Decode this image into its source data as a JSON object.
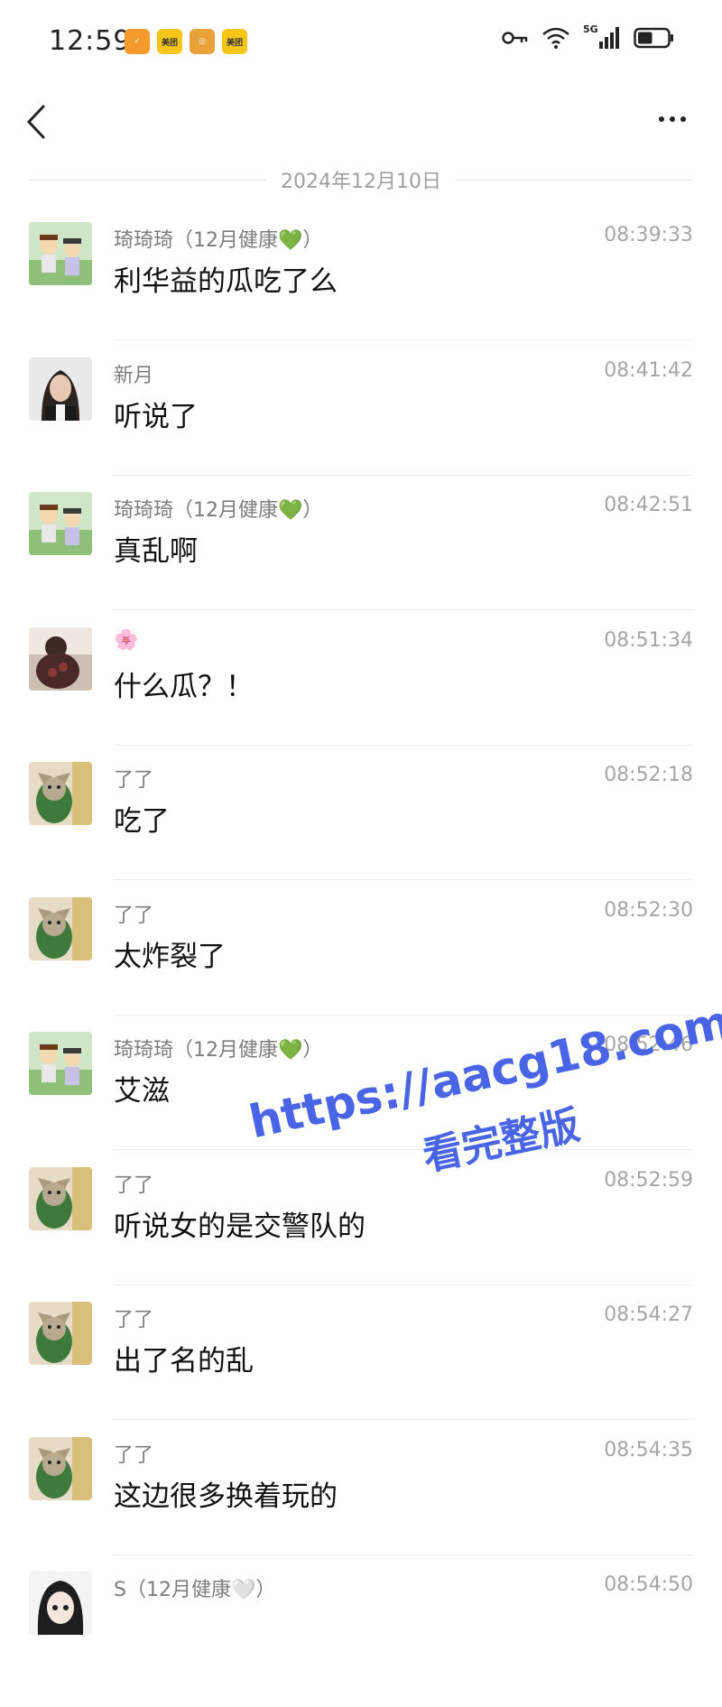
{
  "status_bar": {
    "time": "12:59",
    "notif_icons": [
      "app-icon",
      "meituan-icon",
      "game-icon",
      "meituan-icon"
    ],
    "network": "5G",
    "battery_level": 0.5
  },
  "nav": {
    "back_icon": "chevron-left-icon",
    "more_icon": "more-dots-icon"
  },
  "date_separator": "2024年12月10日",
  "messages": [
    {
      "sender": "琦琦琦（12月健康💚）",
      "time": "08:39:33",
      "text": "利华益的瓜吃了么",
      "avatar": "cartoon-avatar"
    },
    {
      "sender": "新月",
      "time": "08:41:42",
      "text": "听说了",
      "avatar": "woman-avatar"
    },
    {
      "sender": "琦琦琦（12月健康💚）",
      "time": "08:42:51",
      "text": "真乱啊",
      "avatar": "cartoon-avatar"
    },
    {
      "sender": "🌸",
      "time": "08:51:34",
      "text": "什么瓜？！",
      "avatar": "photo-avatar"
    },
    {
      "sender": "了了",
      "time": "08:52:18",
      "text": "吃了",
      "avatar": "cat-avatar"
    },
    {
      "sender": "了了",
      "time": "08:52:30",
      "text": "太炸裂了",
      "avatar": "cat-avatar"
    },
    {
      "sender": "琦琦琦（12月健康💚）",
      "time": "08:52:46",
      "text": "艾滋",
      "avatar": "cartoon-avatar"
    },
    {
      "sender": "了了",
      "time": "08:52:59",
      "text": "听说女的是交警队的",
      "avatar": "cat-avatar"
    },
    {
      "sender": "了了",
      "time": "08:54:27",
      "text": "出了名的乱",
      "avatar": "cat-avatar"
    },
    {
      "sender": "了了",
      "time": "08:54:35",
      "text": "这边很多换着玩的",
      "avatar": "cat-avatar"
    },
    {
      "sender": "S（12月健康🤍）",
      "time": "08:54:50",
      "text": "",
      "avatar": "anime-avatar"
    }
  ],
  "watermark": {
    "line1": "https://aacg18.com",
    "line2": "看完整版"
  },
  "colors": {
    "background": "#ffffff",
    "sender": "#7d7d7d",
    "time": "#a5a5a5",
    "watermark": "#4a64e6"
  }
}
